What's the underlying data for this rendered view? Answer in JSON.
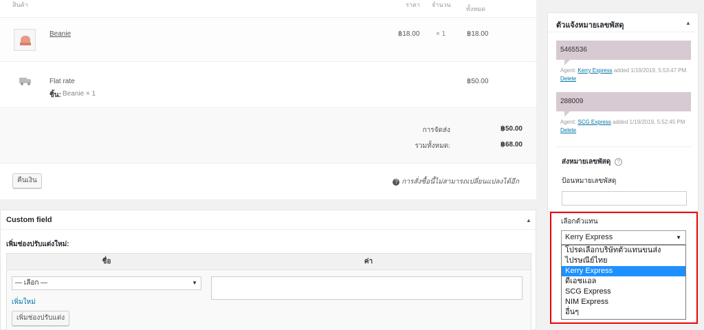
{
  "order": {
    "headers": {
      "product": "สินค้า",
      "price": "ราคา",
      "qty": "จำนวน",
      "total": "ทั้งหมด"
    },
    "item": {
      "name": "Beanie",
      "price": "฿18.00",
      "qty": "× 1",
      "total": "฿18.00"
    },
    "shipping": {
      "method": "Flat rate",
      "items_label": "ชิ้น:",
      "items_value": "Beanie × 1",
      "total": "฿50.00"
    },
    "totals": {
      "shipping_label": "การจัดส่ง",
      "shipping_value": "฿50.00",
      "grand_label": "รวมทั้งหมด:",
      "grand_value": "฿68.00"
    },
    "refund_button": "คืนเงิน",
    "locked_note": "การสั่งซื้อนี้ไม่สามารถเปลี่ยนแปลงได้อีก"
  },
  "custom_field": {
    "title": "Custom field",
    "add_new_label": "เพิ่มช่องปรับแต่งใหม่:",
    "col_name": "ชื่อ",
    "col_value": "ค่า",
    "select_value": "— เลือก —",
    "add_link": "เพิ่มใหม่",
    "add_button": "เพิ่มช่องปรับแต่ง"
  },
  "tracking": {
    "title": "ตัวแจ้งหมายเลขพัสดุ",
    "notes": [
      {
        "number": "5465536",
        "agent_prefix": "Agent:",
        "agent": "Kerry Express",
        "added": "added 1/19/2019, 5:53:47 PM",
        "delete": "Delete"
      },
      {
        "number": "288009",
        "agent_prefix": "Agent:",
        "agent": "SCG Express",
        "added": "added 1/19/2019, 5:52:45 PM",
        "delete": "Delete"
      }
    ],
    "send_label": "ส่งหมายเลขพัสดุ",
    "input_label": "ป้อนหมายเลขพัสดุ",
    "agent_label": "เลือกตัวแทน",
    "agent_selected": "Kerry Express",
    "agent_options": [
      "โปรดเลือกบริษัทตัวแทนขนส่ง",
      "ไปรษณีย์ไทย",
      "Kerry Express",
      "ดีเอชแอล",
      "SCG Express",
      "NIM Express",
      "อื่นๆ"
    ]
  },
  "colors": {
    "highlight": "#ee0000",
    "selected_option": "#1e90ff",
    "note_bg": "#d7cad2",
    "link": "#0073aa"
  }
}
